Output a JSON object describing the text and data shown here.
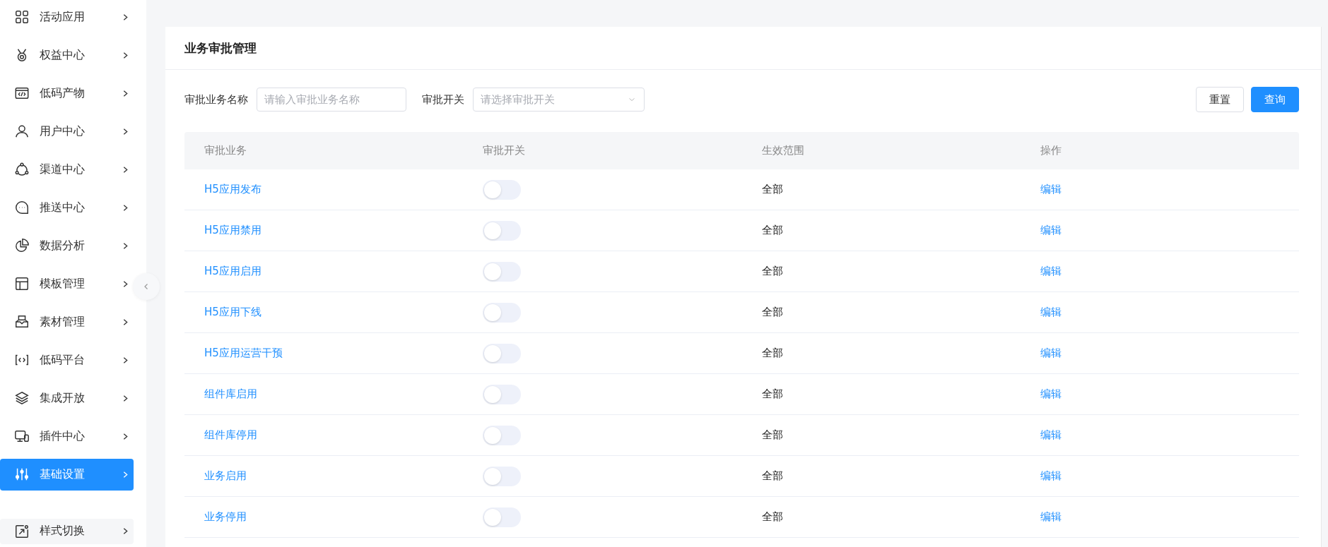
{
  "sidebar": {
    "items": [
      {
        "label": "活动应用",
        "selected": false
      },
      {
        "label": "权益中心",
        "selected": false
      },
      {
        "label": "低码产物",
        "selected": false
      },
      {
        "label": "用户中心",
        "selected": false
      },
      {
        "label": "渠道中心",
        "selected": false
      },
      {
        "label": "推送中心",
        "selected": false
      },
      {
        "label": "数据分析",
        "selected": false
      },
      {
        "label": "模板管理",
        "selected": false
      },
      {
        "label": "素材管理",
        "selected": false
      },
      {
        "label": "低码平台",
        "selected": false
      },
      {
        "label": "集成开放",
        "selected": false
      },
      {
        "label": "插件中心",
        "selected": false
      },
      {
        "label": "基础设置",
        "selected": true
      }
    ],
    "footer_item": {
      "label": "样式切换"
    }
  },
  "page": {
    "title": "业务审批管理"
  },
  "filters": [
    {
      "kind": "input",
      "label": "审批业务名称",
      "placeholder": "请输入审批业务名称"
    },
    {
      "kind": "select",
      "label": "审批开关",
      "placeholder": "请选择审批开关"
    }
  ],
  "buttons": [
    {
      "label": "重置",
      "kind": "default"
    },
    {
      "label": "查询",
      "kind": "primary"
    }
  ],
  "table": {
    "columns": [
      "审批业务",
      "审批开关",
      "生效范围",
      "操作"
    ],
    "rows": [
      {
        "name": "H5应用发布",
        "on": false,
        "scope": "全部",
        "action": "编辑"
      },
      {
        "name": "H5应用禁用",
        "on": false,
        "scope": "全部",
        "action": "编辑"
      },
      {
        "name": "H5应用启用",
        "on": false,
        "scope": "全部",
        "action": "编辑"
      },
      {
        "name": "H5应用下线",
        "on": false,
        "scope": "全部",
        "action": "编辑"
      },
      {
        "name": "H5应用运营干预",
        "on": false,
        "scope": "全部",
        "action": "编辑"
      },
      {
        "name": "组件库启用",
        "on": false,
        "scope": "全部",
        "action": "编辑"
      },
      {
        "name": "组件库停用",
        "on": false,
        "scope": "全部",
        "action": "编辑"
      },
      {
        "name": "业务启用",
        "on": false,
        "scope": "全部",
        "action": "编辑"
      },
      {
        "name": "业务停用",
        "on": false,
        "scope": "全部",
        "action": "编辑"
      }
    ]
  }
}
